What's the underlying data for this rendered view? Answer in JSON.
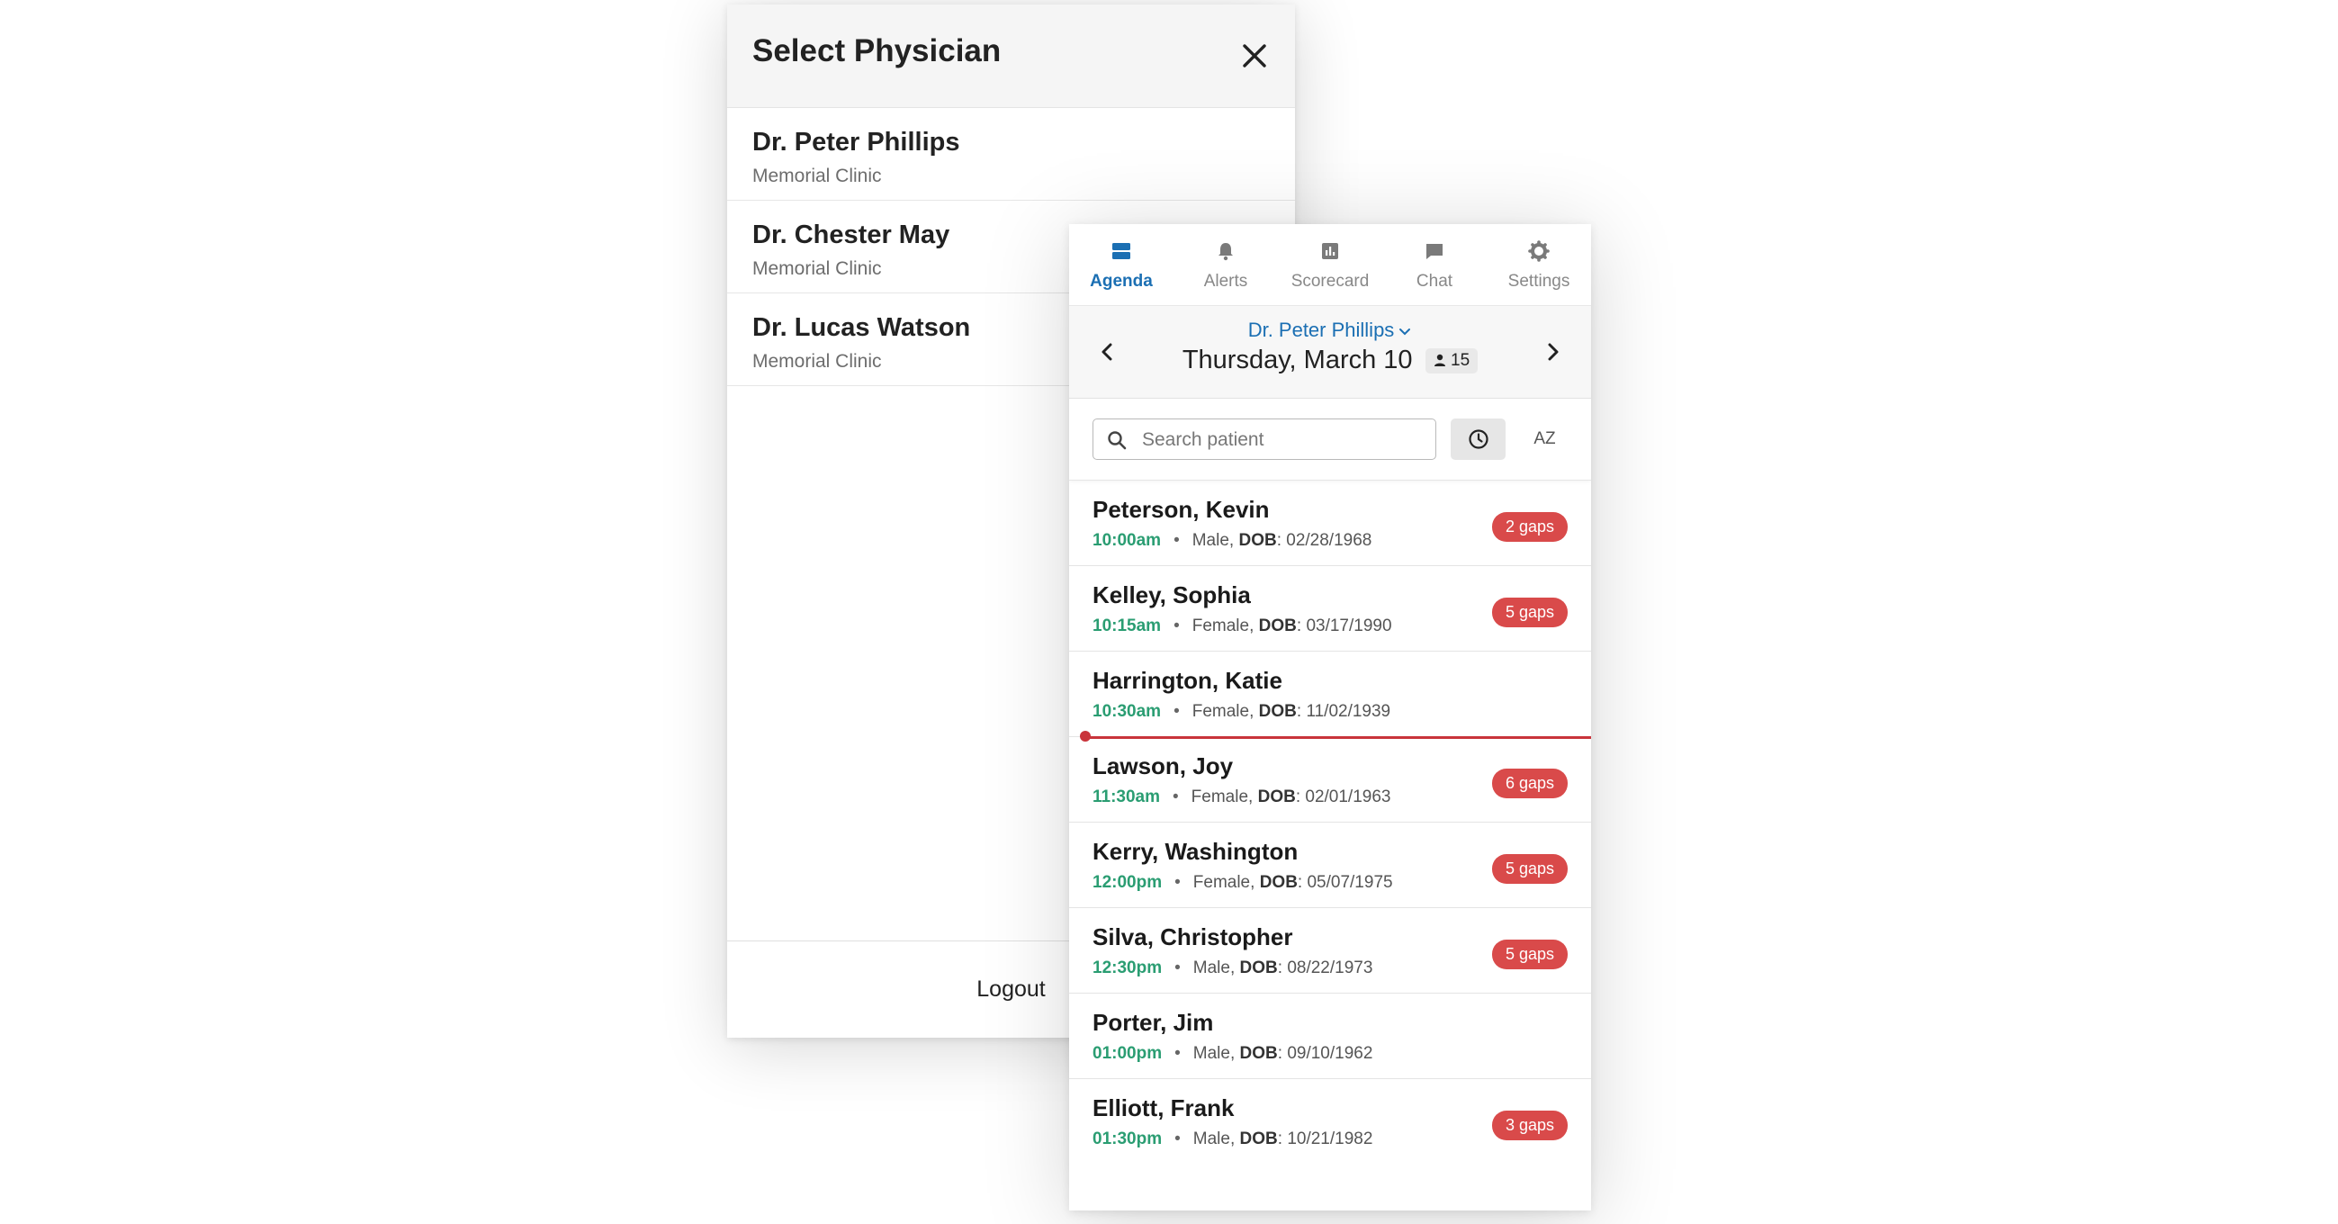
{
  "physician_dialog": {
    "title": "Select Physician",
    "physicians": [
      {
        "name": "Dr. Peter Phillips",
        "clinic": "Memorial Clinic"
      },
      {
        "name": "Dr. Chester May",
        "clinic": "Memorial Clinic"
      },
      {
        "name": "Dr. Lucas Watson",
        "clinic": "Memorial Clinic"
      }
    ],
    "logout_label": "Logout"
  },
  "nav": {
    "tabs": [
      {
        "label": "Agenda",
        "icon": "agenda-icon",
        "active": true
      },
      {
        "label": "Alerts",
        "icon": "bell-icon",
        "active": false
      },
      {
        "label": "Scorecard",
        "icon": "bar-chart-icon",
        "active": false
      },
      {
        "label": "Chat",
        "icon": "chat-icon",
        "active": false
      },
      {
        "label": "Settings",
        "icon": "gear-icon",
        "active": false
      }
    ]
  },
  "agenda": {
    "physician": "Dr. Peter Phillips",
    "date": "Thursday, March 10",
    "patient_count": "15",
    "search_placeholder": "Search patient",
    "sort_az_label": "AZ",
    "dob_label": "DOB",
    "separator": "•",
    "patients": [
      {
        "name": "Peterson, Kevin",
        "time": "10:00am",
        "sex": "Male",
        "dob": "02/28/1968",
        "gaps": "2 gaps"
      },
      {
        "name": "Kelley, Sophia",
        "time": "10:15am",
        "sex": "Female",
        "dob": "03/17/1990",
        "gaps": "5 gaps"
      },
      {
        "name": "Harrington, Katie",
        "time": "10:30am",
        "sex": "Female",
        "dob": "11/02/1939",
        "gaps": ""
      },
      {
        "name": "Lawson, Joy",
        "time": "11:30am",
        "sex": "Female",
        "dob": "02/01/1963",
        "gaps": "6 gaps"
      },
      {
        "name": "Kerry, Washington",
        "time": "12:00pm",
        "sex": "Female",
        "dob": "05/07/1975",
        "gaps": "5 gaps"
      },
      {
        "name": "Silva, Christopher",
        "time": "12:30pm",
        "sex": "Male",
        "dob": "08/22/1973",
        "gaps": "5 gaps"
      },
      {
        "name": "Porter, Jim",
        "time": "01:00pm",
        "sex": "Male",
        "dob": "09/10/1962",
        "gaps": ""
      },
      {
        "name": "Elliott, Frank",
        "time": "01:30pm",
        "sex": "Male",
        "dob": "10/21/1982",
        "gaps": "3 gaps"
      }
    ]
  },
  "colors": {
    "accent": "#1b6fb3",
    "time_green": "#2a9d72",
    "gaps_red": "#d94a4a",
    "now_line": "#c9343b"
  }
}
